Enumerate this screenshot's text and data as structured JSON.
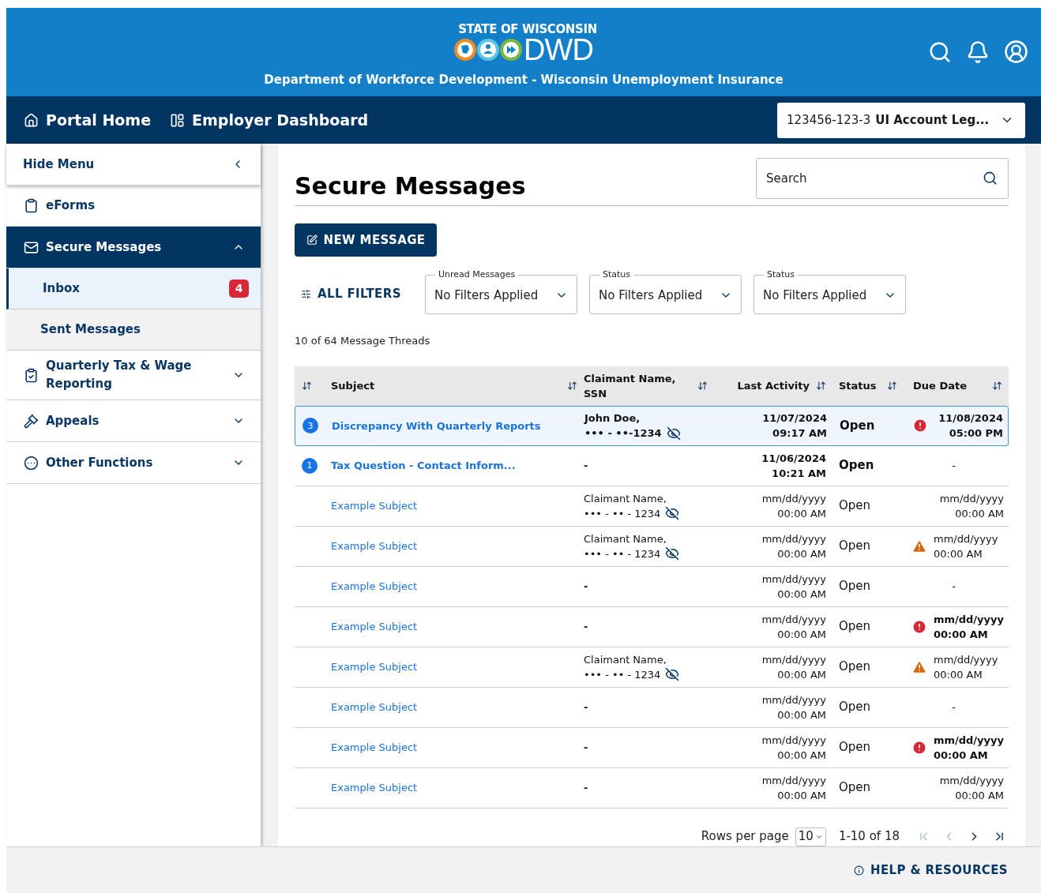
{
  "header": {
    "state": "STATE OF WISCONSIN",
    "logo": "DWD",
    "subtitle": "Department of Workforce Development - Wisconsin Unemployment Insurance"
  },
  "nav": {
    "links": [
      {
        "label": "Portal Home"
      },
      {
        "label": "Employer Dashboard"
      }
    ],
    "account": {
      "number": "123456-123-3",
      "name": "UI Account Leg..."
    }
  },
  "sidebar": {
    "hide_label": "Hide Menu",
    "items": [
      {
        "label": "eForms",
        "expandable": false,
        "selected": false
      },
      {
        "label": "Secure Messages",
        "expandable": true,
        "expanded": true,
        "selected": true,
        "children": [
          {
            "label": "Inbox",
            "badge": "4",
            "selected": true
          },
          {
            "label": "Sent Messages",
            "selected": false
          }
        ]
      },
      {
        "label": "Quarterly Tax & Wage Reporting",
        "expandable": true,
        "expanded": false,
        "selected": false
      },
      {
        "label": "Appeals",
        "expandable": true,
        "expanded": false,
        "selected": false
      },
      {
        "label": "Other Functions",
        "expandable": true,
        "expanded": false,
        "selected": false
      }
    ]
  },
  "main": {
    "title": "Secure Messages",
    "search": {
      "placeholder": "Search"
    },
    "new_message": "NEW MESSAGE",
    "all_filters": "ALL FILTERS",
    "filters": [
      {
        "label": "Unread Messages",
        "value": "No Filters Applied"
      },
      {
        "label": "Status",
        "value": "No Filters Applied"
      },
      {
        "label": "Status",
        "value": "No Filters Applied"
      }
    ],
    "count": "10 of 64 Message Threads",
    "table": {
      "columns": [
        "Subject",
        "Claimant Name, SSN",
        "Last Activity",
        "Status",
        "Due Date"
      ],
      "rows": [
        {
          "unread": "3",
          "selected": true,
          "subject": "Discrepancy With Quarterly Reports",
          "claimant": {
            "name": "John Doe,",
            "ssn": "••• - ••-1234"
          },
          "activity": [
            "11/07/2024",
            "09:17 AM"
          ],
          "status": "Open",
          "due": {
            "kind": "error",
            "lines": [
              "11/08/2024",
              "05:00 PM"
            ]
          }
        },
        {
          "unread": "1",
          "selected": false,
          "subject": "Tax Question - Contact Inform...",
          "claimant": {
            "text": "-"
          },
          "activity": [
            "11/06/2024",
            "10:21 AM"
          ],
          "status": "Open",
          "due": {
            "kind": "empty",
            "text": "-"
          }
        },
        {
          "selected": false,
          "subject": "Example Subject",
          "claimant": {
            "name": "Claimant Name,",
            "ssn": "••• - •• - 1234"
          },
          "activity": [
            "mm/dd/yyyy",
            "00:00 AM"
          ],
          "status": "Open",
          "due": {
            "kind": "plain",
            "lines": [
              "mm/dd/yyyy",
              "00:00 AM"
            ]
          }
        },
        {
          "selected": false,
          "subject": "Example Subject",
          "claimant": {
            "name": "Claimant Name,",
            "ssn": "••• - •• - 1234"
          },
          "activity": [
            "mm/dd/yyyy",
            "00:00 AM"
          ],
          "status": "Open",
          "due": {
            "kind": "warning",
            "lines": [
              "mm/dd/yyyy",
              "00:00 AM"
            ]
          }
        },
        {
          "selected": false,
          "subject": "Example Subject",
          "claimant": {
            "text": "-"
          },
          "activity": [
            "mm/dd/yyyy",
            "00:00 AM"
          ],
          "status": "Open",
          "due": {
            "kind": "empty",
            "text": "-"
          }
        },
        {
          "selected": false,
          "subject": "Example Subject",
          "claimant": {
            "text": "-"
          },
          "activity": [
            "mm/dd/yyyy",
            "00:00 AM"
          ],
          "status": "Open",
          "due": {
            "kind": "error",
            "lines": [
              "mm/dd/yyyy",
              "00:00 AM"
            ]
          }
        },
        {
          "selected": false,
          "subject": "Example Subject",
          "claimant": {
            "name": "Claimant Name,",
            "ssn": "••• - •• - 1234"
          },
          "activity": [
            "mm/dd/yyyy",
            "00:00 AM"
          ],
          "status": "Open",
          "due": {
            "kind": "warning",
            "lines": [
              "mm/dd/yyyy",
              "00:00 AM"
            ]
          }
        },
        {
          "selected": false,
          "subject": "Example Subject",
          "claimant": {
            "text": "-"
          },
          "activity": [
            "mm/dd/yyyy",
            "00:00 AM"
          ],
          "status": "Open",
          "due": {
            "kind": "empty",
            "text": "-"
          }
        },
        {
          "selected": false,
          "subject": "Example Subject",
          "claimant": {
            "text": "-"
          },
          "activity": [
            "mm/dd/yyyy",
            "00:00 AM"
          ],
          "status": "Open",
          "due": {
            "kind": "error",
            "lines": [
              "mm/dd/yyyy",
              "00:00 AM"
            ]
          }
        },
        {
          "selected": false,
          "subject": "Example Subject",
          "claimant": {
            "text": "-"
          },
          "activity": [
            "mm/dd/yyyy",
            "00:00 AM"
          ],
          "status": "Open",
          "due": {
            "kind": "plain",
            "lines": [
              "mm/dd/yyyy",
              "00:00 AM"
            ]
          }
        }
      ]
    },
    "pagination": {
      "rows_label": "Rows per page",
      "rows_value": "10",
      "range": "1-10 of 18",
      "buttons": [
        {
          "disabled": true
        },
        {
          "disabled": true
        },
        {
          "disabled": false
        },
        {
          "disabled": false
        }
      ]
    }
  },
  "footer": {
    "help": "HELP & RESOURCES"
  }
}
